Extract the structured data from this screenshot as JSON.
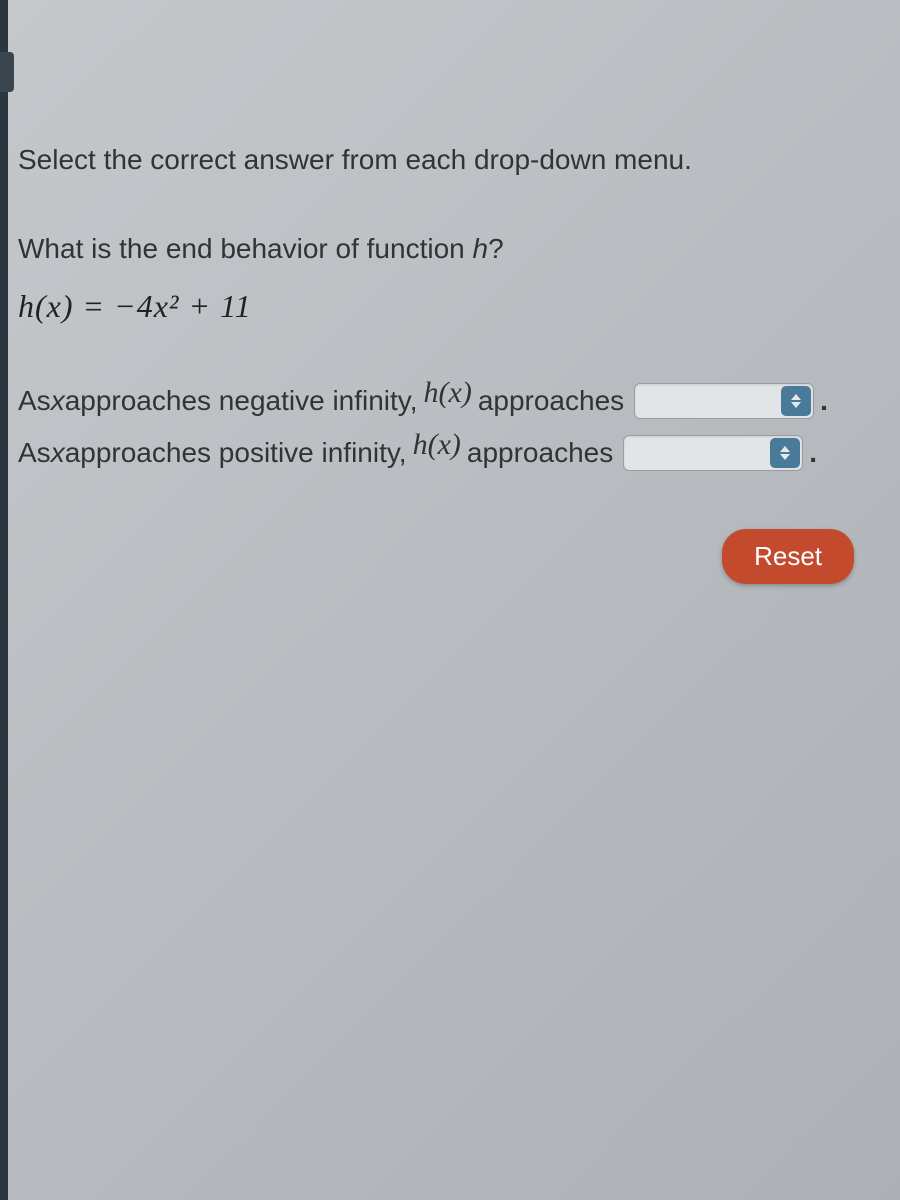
{
  "instruction": "Select the correct answer from each drop-down menu.",
  "question_prefix": "What is the end behavior of function ",
  "question_func": "h",
  "question_suffix": "?",
  "equation": "h(x) = −4x² + 11",
  "row1": {
    "prefix": "As ",
    "var": "x",
    "mid1": " approaches negative infinity, ",
    "hx": "h(x)",
    "mid2": " approaches"
  },
  "row2": {
    "prefix": "As ",
    "var": "x",
    "mid1": " approaches positive infinity, ",
    "hx": "h(x)",
    "mid2": " approaches"
  },
  "dropdown1_value": "",
  "dropdown2_value": "",
  "period": ".",
  "reset_label": "Reset"
}
